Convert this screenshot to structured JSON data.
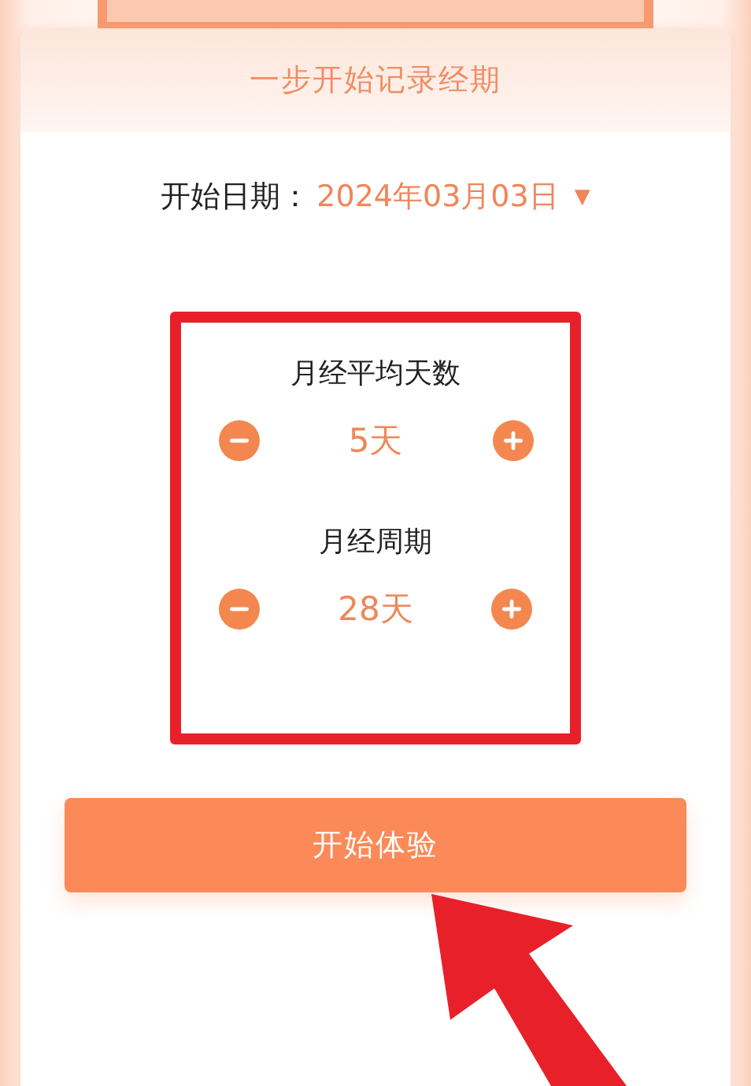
{
  "card": {
    "title": "一步开始记录经期"
  },
  "start_date": {
    "label": "开始日期：",
    "value": "2024年03月03日",
    "dropdown_icon": "▼"
  },
  "steppers": [
    {
      "label": "月经平均天数",
      "value": "5天"
    },
    {
      "label": "月经周期",
      "value": "28天"
    }
  ],
  "start_button": {
    "label": "开始体验"
  }
}
